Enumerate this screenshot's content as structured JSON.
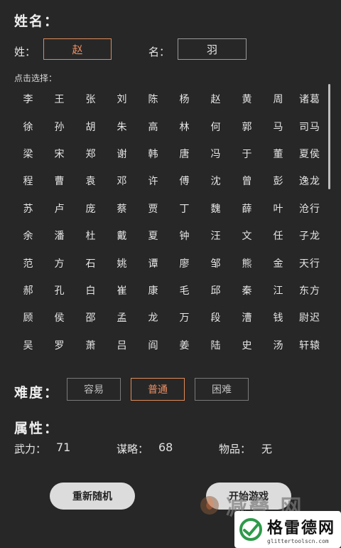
{
  "name_section": {
    "title": "姓名：",
    "surname_label": "姓：",
    "surname_value": "赵",
    "given_label": "名：",
    "given_value": "羽"
  },
  "picker": {
    "hint": "点击选择：",
    "surnames": [
      "李",
      "王",
      "张",
      "刘",
      "陈",
      "杨",
      "赵",
      "黄",
      "周",
      "诸葛",
      "徐",
      "孙",
      "胡",
      "朱",
      "高",
      "林",
      "何",
      "郭",
      "马",
      "司马",
      "梁",
      "宋",
      "郑",
      "谢",
      "韩",
      "唐",
      "冯",
      "于",
      "董",
      "夏侯",
      "程",
      "曹",
      "袁",
      "邓",
      "许",
      "傅",
      "沈",
      "曾",
      "彭",
      "逸龙",
      "苏",
      "卢",
      "庞",
      "蔡",
      "贾",
      "丁",
      "魏",
      "薛",
      "叶",
      "沧行",
      "余",
      "潘",
      "杜",
      "戴",
      "夏",
      "钟",
      "汪",
      "文",
      "任",
      "子龙",
      "范",
      "方",
      "石",
      "姚",
      "谭",
      "廖",
      "邹",
      "熊",
      "金",
      "天行",
      "郝",
      "孔",
      "白",
      "崔",
      "康",
      "毛",
      "邱",
      "秦",
      "江",
      "东方",
      "顾",
      "侯",
      "邵",
      "孟",
      "龙",
      "万",
      "段",
      "漕",
      "钱",
      "尉迟",
      "吴",
      "罗",
      "萧",
      "吕",
      "阎",
      "姜",
      "陆",
      "史",
      "汤",
      "轩辕"
    ]
  },
  "difficulty": {
    "title": "难度：",
    "options": [
      "容易",
      "普通",
      "困难"
    ],
    "selected": "普通"
  },
  "attributes": {
    "title": "属性：",
    "force_label": "武力：",
    "force_value": "71",
    "strategy_label": "谋略：",
    "strategy_value": "68",
    "item_label": "物品：",
    "item_value": "无"
  },
  "actions": {
    "reroll": "重新随机",
    "start": "开始游戏"
  },
  "watermark": {
    "text": "减叠 网",
    "site_name": "格雷德网",
    "site_url": "glittertoolscn.com"
  },
  "colors": {
    "accent": "#ee8f62",
    "background": "#272727"
  }
}
